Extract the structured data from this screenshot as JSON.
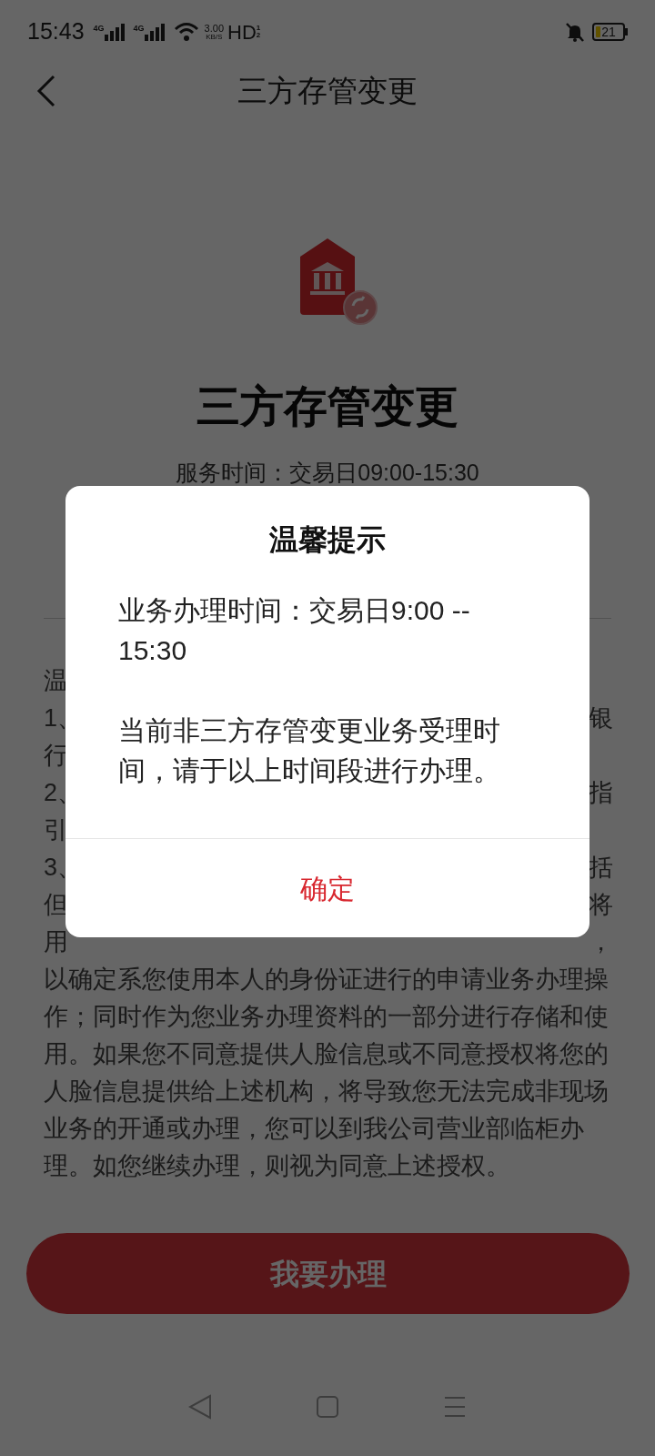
{
  "status_bar": {
    "time": "15:43",
    "network_1": "4G",
    "network_2": "4G",
    "speed": "3.00",
    "speed_unit": "KB/S",
    "hd": "HD",
    "sim_1": "1",
    "sim_2": "2",
    "battery": "21"
  },
  "header": {
    "title": "三方存管变更"
  },
  "hero": {
    "title": "三方存管变更",
    "service_time": "服务时间：交易日09:00-15:30"
  },
  "notice_lines": [
    {
      "left": "温"
    },
    {
      "left": "1、",
      "right": "银"
    },
    {
      "left": "行"
    },
    {
      "left": "2、",
      "right": "指"
    },
    {
      "left": "引"
    },
    {
      "left": "3、",
      "right": "括"
    },
    {
      "left": "但",
      "right": "将"
    },
    {
      "left": "用",
      "right": "，"
    }
  ],
  "notice_paragraph": "以确定系您使用本人的身份证进行的申请业务办理操作；同时作为您业务办理资料的一部分进行存储和使用。如果您不同意提供人脸信息或不同意授权将您的人脸信息提供给上述机构，将导致您无法完成非现场业务的开通或办理，您可以到我公司营业部临柜办理。如您继续办理，则视为同意上述授权。",
  "apply_button": "我要办理",
  "dialog": {
    "title": "温馨提示",
    "paragraphs": [
      "业务办理时间：交易日9:00 -- 15:30",
      "当前非三方存管变更业务受理时间，请于以上时间段进行办理。"
    ],
    "confirm": "确定"
  }
}
